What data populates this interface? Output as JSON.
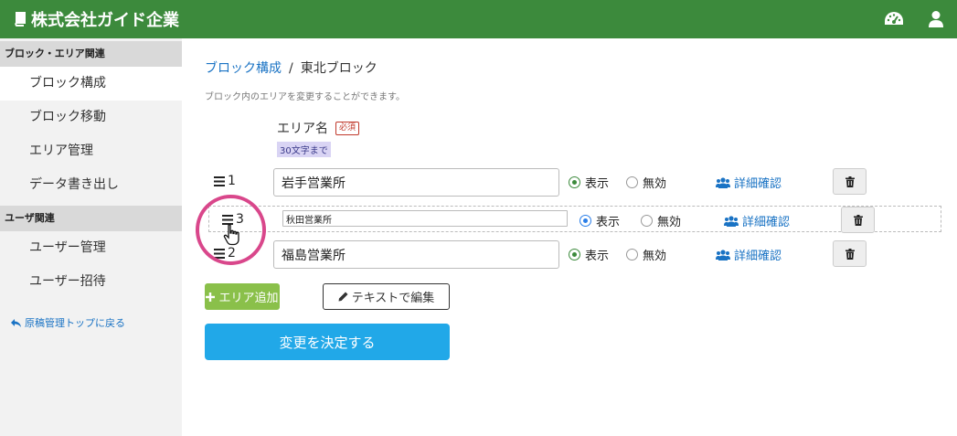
{
  "header": {
    "brand": "株式会社ガイド企業",
    "icons": [
      "dashboard-icon",
      "user-icon"
    ],
    "color": "#3c8a3c"
  },
  "sidebar": {
    "sections": [
      {
        "heading": "ブロック・エリア関連",
        "items": [
          "ブロック構成",
          "ブロック移動",
          "エリア管理",
          "データ書き出し"
        ]
      },
      {
        "heading": "ユーザ関連",
        "items": [
          "ユーザー管理",
          "ユーザー招待"
        ]
      }
    ],
    "back_link": "原稿管理トップに戻る"
  },
  "main": {
    "breadcrumb": {
      "parent": "ブロック構成",
      "separator": "/",
      "current": "東北ブロック"
    },
    "description": "ブロック内のエリアを変更することができます。",
    "area_label": "エリア名",
    "required_badge": "必須",
    "limit_hint": "30文字まで",
    "rows": [
      {
        "order": "1",
        "name": "岩手営業所",
        "display_label": "表示",
        "disable_label": "無効",
        "status": "表示",
        "detail_label": "詳細確認"
      },
      {
        "order": "3",
        "name": "秋田営業所",
        "display_label": "表示",
        "disable_label": "無効",
        "status": "表示",
        "detail_label": "詳細確認"
      },
      {
        "order": "2",
        "name": "福島営業所",
        "display_label": "表示",
        "disable_label": "無効",
        "status": "表示",
        "detail_label": "詳細確認"
      }
    ],
    "add_button": "エリア追加",
    "edit_text_button": "テキストで編集",
    "submit_button": "変更を決定する"
  }
}
